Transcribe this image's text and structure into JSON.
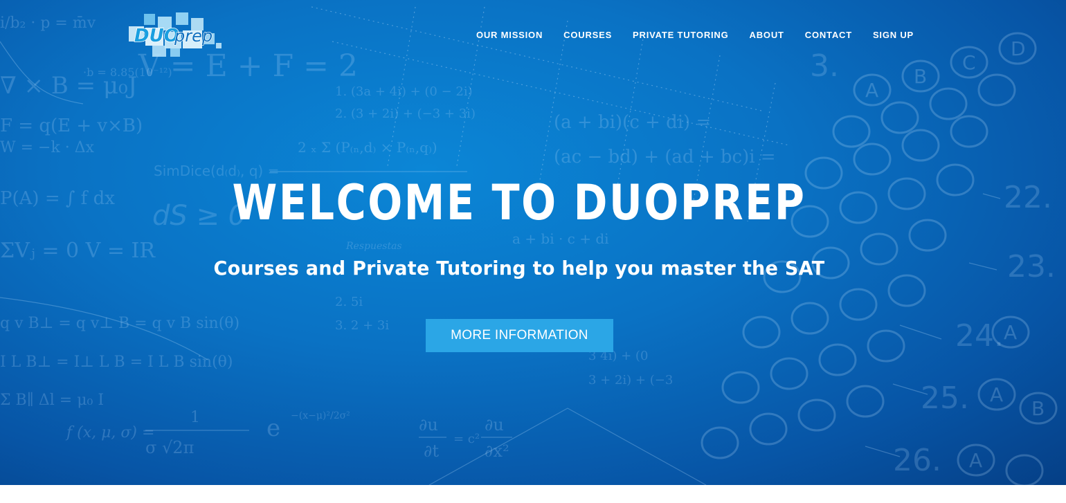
{
  "logo": {
    "text_duo": "DUO",
    "text_prep": "prep"
  },
  "nav": {
    "items": [
      {
        "label": "OUR MISSION"
      },
      {
        "label": "COURSES"
      },
      {
        "label": "PRIVATE TUTORING"
      },
      {
        "label": "ABOUT"
      },
      {
        "label": "CONTACT"
      },
      {
        "label": "SIGN UP"
      }
    ]
  },
  "hero": {
    "title": "WELCOME TO DUOPREP",
    "subtitle": "Courses and Private Tutoring to help you master the SAT",
    "cta_label": "MORE INFORMATION"
  },
  "colors": {
    "hero_bg": "#0a72c4",
    "cta_bg": "#2ba6e6",
    "text": "#ffffff",
    "logo_accent": "#1a9fe0"
  }
}
